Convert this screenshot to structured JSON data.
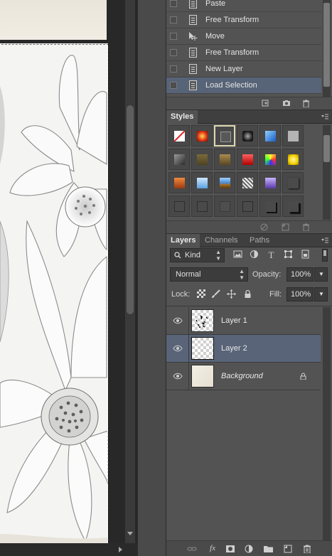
{
  "history": {
    "items": [
      {
        "label": "Paste",
        "icon": "document-icon",
        "selected": false
      },
      {
        "label": "Free Transform",
        "icon": "document-icon",
        "selected": false
      },
      {
        "label": "Move",
        "icon": "move-tool-icon",
        "selected": false
      },
      {
        "label": "Free Transform",
        "icon": "document-icon",
        "selected": false
      },
      {
        "label": "New Layer",
        "icon": "document-icon",
        "selected": false
      },
      {
        "label": "Load Selection",
        "icon": "document-icon",
        "selected": true
      }
    ]
  },
  "styles": {
    "tab_label": "Styles"
  },
  "layers": {
    "tabs": [
      {
        "label": "Layers",
        "active": true
      },
      {
        "label": "Channels",
        "active": false
      },
      {
        "label": "Paths",
        "active": false
      }
    ],
    "filter_kind": "Kind",
    "blend_mode": "Normal",
    "opacity_label": "Opacity:",
    "opacity_value": "100%",
    "lock_label": "Lock:",
    "fill_label": "Fill:",
    "fill_value": "100%",
    "items": [
      {
        "name": "Layer 1",
        "visible": true,
        "selected": false,
        "italic": false,
        "locked": false
      },
      {
        "name": "Layer 2",
        "visible": true,
        "selected": true,
        "italic": false,
        "locked": false
      },
      {
        "name": "Background",
        "visible": true,
        "selected": false,
        "italic": true,
        "locked": true
      }
    ]
  },
  "colors": {
    "selection": "#576377",
    "panel_bg": "#535353",
    "canvas_bg": "#282828"
  }
}
